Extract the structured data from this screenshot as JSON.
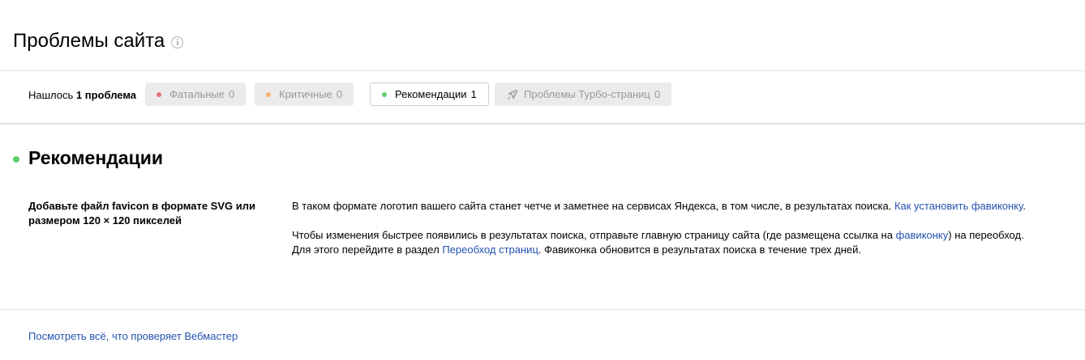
{
  "header": {
    "title": "Проблемы сайта",
    "info_icon": "info-circle-icon"
  },
  "filters": {
    "found_prefix": "Нашлось",
    "found_count": "1 проблема",
    "chips": [
      {
        "label": "Фатальные",
        "count": "0",
        "state": "disabled",
        "dot_color": "#e57373"
      },
      {
        "label": "Критичные",
        "count": "0",
        "state": "disabled",
        "dot_color": "#f5b36b"
      },
      {
        "label": "Рекомендации",
        "count": "1",
        "state": "active",
        "dot_color": "#5fcc70"
      },
      {
        "label": "Проблемы Турбо-страниц",
        "count": "0",
        "state": "disabled",
        "icon": "rocket-icon"
      }
    ]
  },
  "section": {
    "title": "Рекомендации",
    "dot_color": "#5fcc70"
  },
  "recommendation": {
    "title": "Добавьте файл favicon в формате SVG или размером 120 × 120 пикселей",
    "p1_text": "В таком формате логотип вашего сайта станет четче и заметнее на сервисах Яндекса, в том числе, в результатах поиска. ",
    "p1_link": "Как установить фавиконку",
    "p1_end": ".",
    "p2_text1": "Чтобы изменения быстрее появились в результатах поиска, отправьте главную страницу сайта (где размещена ссылка на ",
    "p2_link1": "фавиконку",
    "p2_text2": ") на переобход. Для этого перейдите в раздел ",
    "p2_link2": "Переобход страниц",
    "p2_text3": ". Фавиконка обновится в результатах поиска в течение трех дней."
  },
  "footer": {
    "link": "Посмотреть всё, что проверяет Вебмастер"
  },
  "colors": {
    "link": "#2452b0",
    "chip_disabled_bg": "#ebebeb",
    "chip_disabled_text": "#999999"
  }
}
